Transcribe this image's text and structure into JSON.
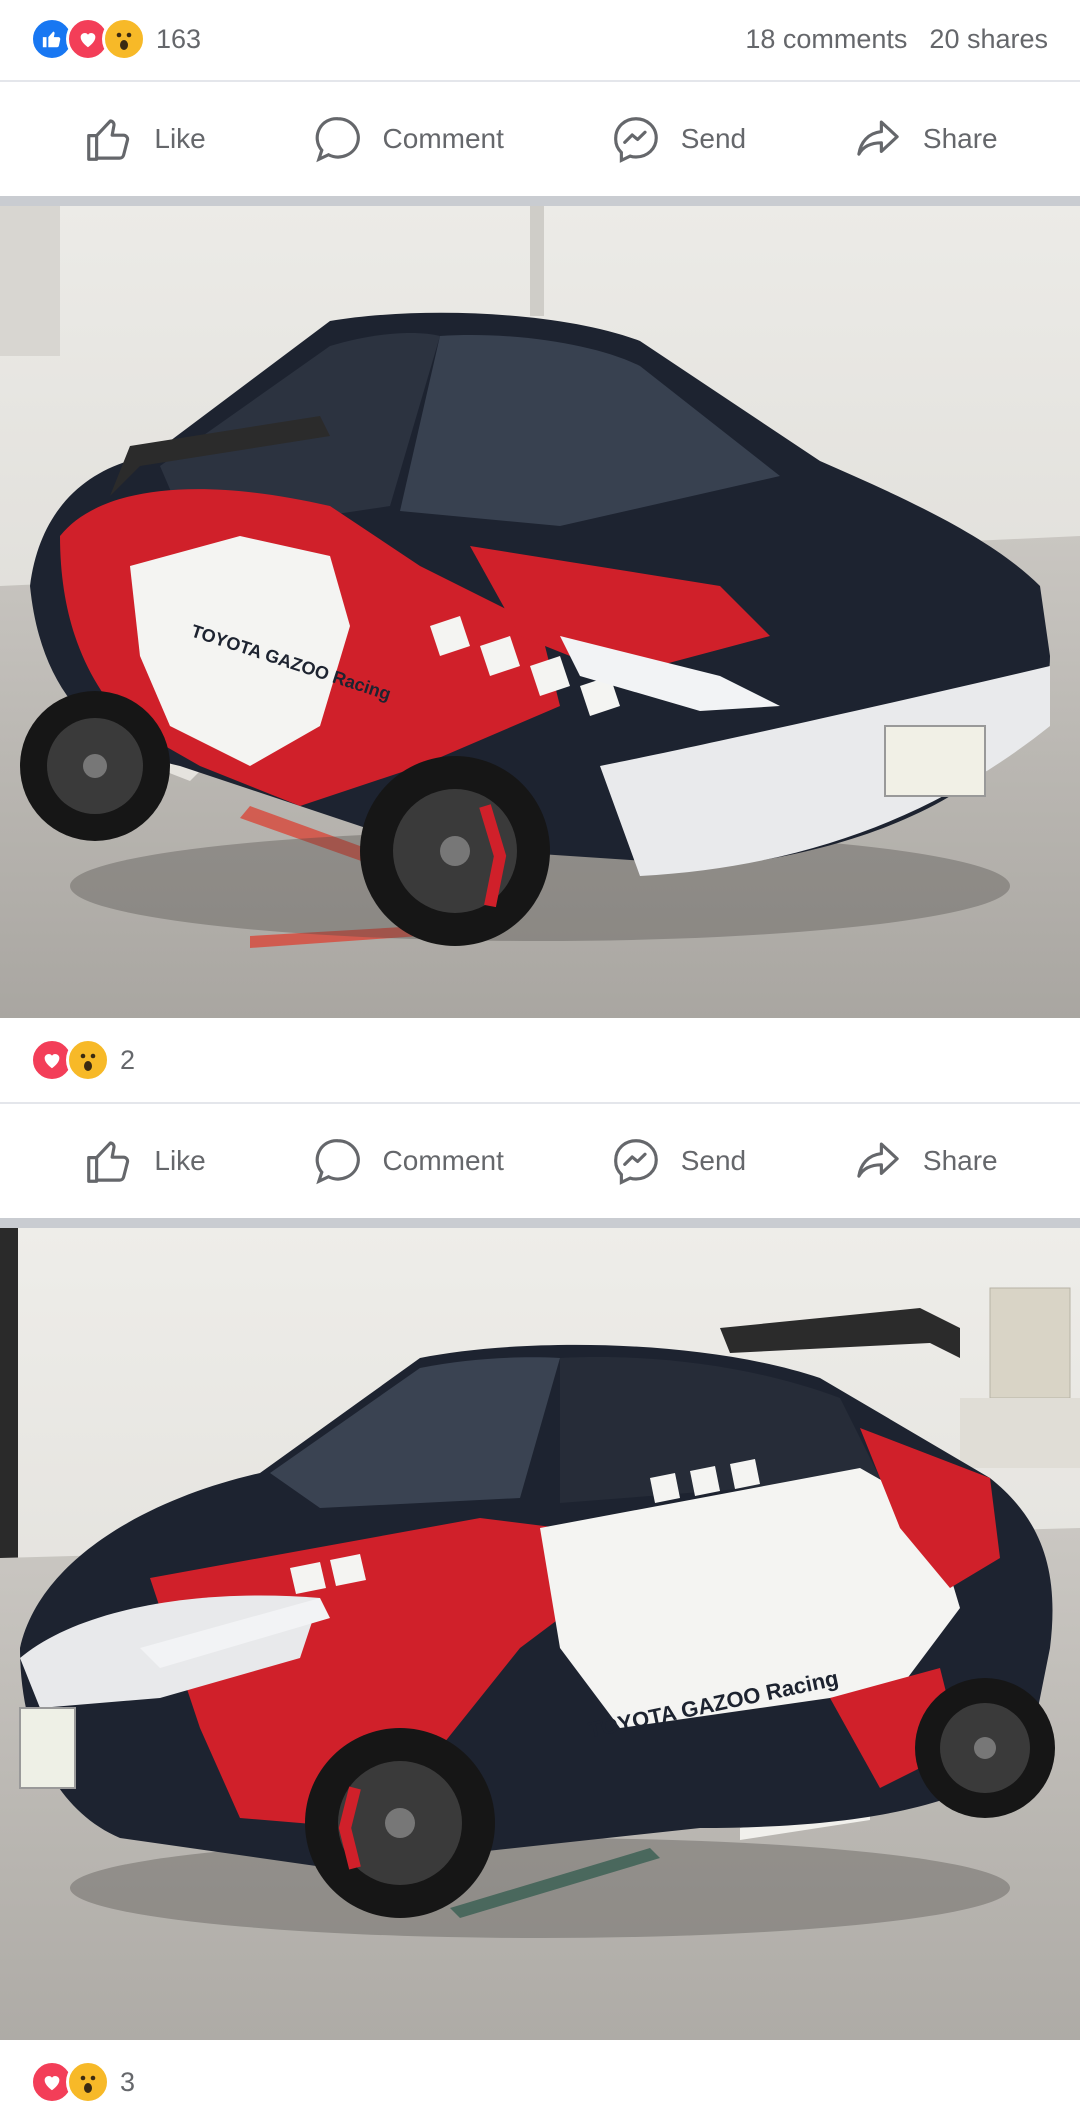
{
  "post1": {
    "reactions": [
      "like",
      "love",
      "wow"
    ],
    "reaction_count": "163",
    "comments": "18 comments",
    "shares": "20 shares"
  },
  "actions": {
    "like": "Like",
    "comment": "Comment",
    "send": "Send",
    "share": "Share"
  },
  "photo1": {
    "description_icon": "car-photo",
    "car_text": "TOYOTA GAZOO Racing",
    "reactions": [
      "love",
      "wow"
    ],
    "reaction_count": "2"
  },
  "photo2": {
    "description_icon": "car-photo",
    "car_text": "TOYOTA GAZOO Racing",
    "reactions": [
      "love",
      "wow"
    ],
    "reaction_count": "3"
  },
  "colors": {
    "like_blue": "#1877f2",
    "love_red": "#f33e58",
    "wow_yellow": "#f7b928",
    "text_gray": "#65676b",
    "car_red": "#d0202a",
    "car_dark": "#1d2330"
  }
}
